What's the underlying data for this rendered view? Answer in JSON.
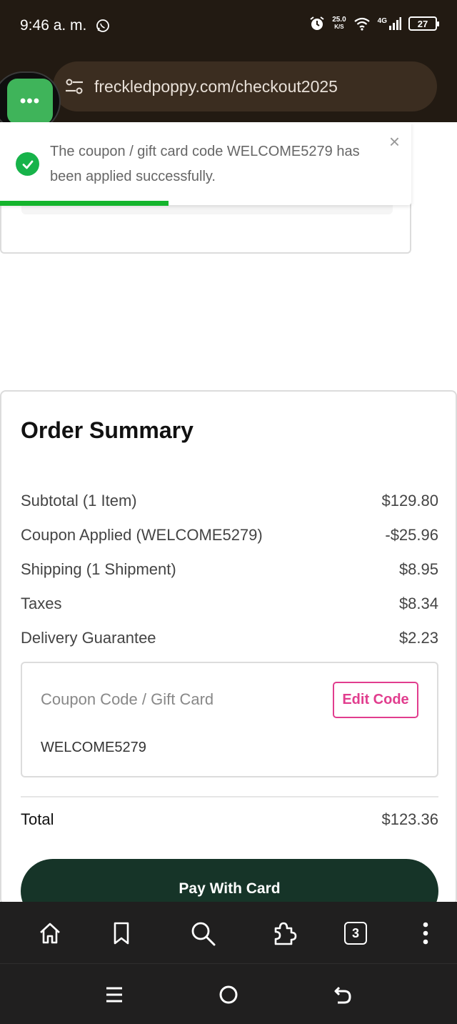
{
  "status_bar": {
    "time": "9:46 a. m.",
    "speed_value": "25.0",
    "speed_unit": "K/S",
    "network": "4G",
    "battery": "27"
  },
  "browser": {
    "url": "freckledpoppy.com/checkout2025",
    "bubble_label": "•••",
    "tab_count": "3"
  },
  "toast": {
    "message": "The coupon / gift card code WELCOME5279 has been applied successfully.",
    "close_label": "×",
    "progress": 0.41
  },
  "order_summary": {
    "title": "Order Summary",
    "lines": [
      {
        "label": "Subtotal (1 Item)",
        "amount": "$129.80"
      },
      {
        "label": "Coupon Applied (WELCOME5279)",
        "amount": "-$25.96"
      },
      {
        "label": "Shipping (1 Shipment)",
        "amount": "$8.95"
      },
      {
        "label": "Taxes",
        "amount": "$8.34"
      },
      {
        "label": "Delivery Guarantee",
        "amount": "$2.23"
      }
    ],
    "coupon": {
      "label": "Coupon Code / Gift Card",
      "edit_label": "Edit Code",
      "value": "WELCOME5279"
    },
    "total_label": "Total",
    "total_amount": "$123.36",
    "pay_label": "Pay With Card"
  },
  "colors": {
    "chrome": "#221a12",
    "accent_pink": "#e13d8e",
    "pay_button": "#163428",
    "success_green": "#14b42c"
  },
  "icons": {
    "browser_bar": [
      "home-icon",
      "bookmark-icon",
      "search-icon",
      "extensions-icon",
      "tabs-icon",
      "more-vert-icon"
    ],
    "nav_bar": [
      "recents-icon",
      "home-circle-icon",
      "back-icon"
    ]
  }
}
